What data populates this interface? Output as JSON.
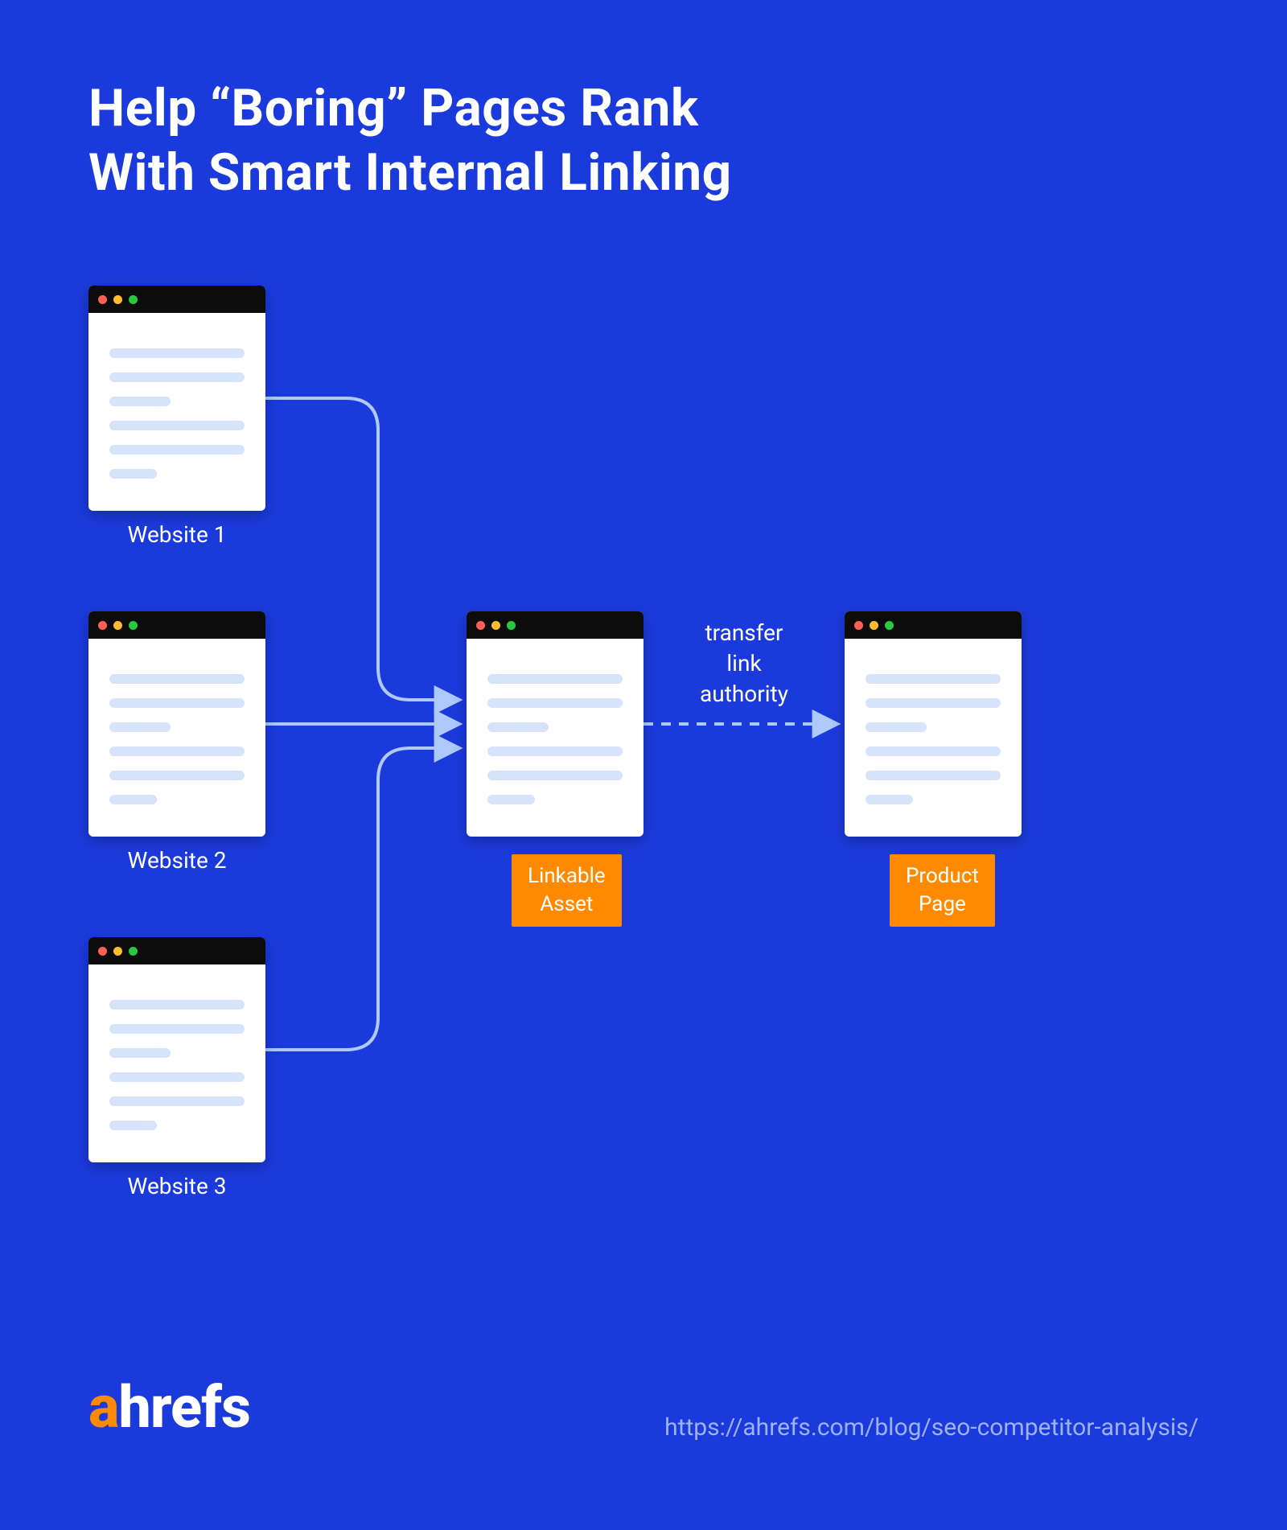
{
  "title": "Help “Boring” Pages Rank\nWith Smart Internal Linking",
  "websites": [
    {
      "label": "Website 1"
    },
    {
      "label": "Website 2"
    },
    {
      "label": "Website 3"
    }
  ],
  "linkable_asset_tag": "Linkable\nAsset",
  "product_page_tag": "Product\nPage",
  "transfer_label": "transfer\nlink\nauthority",
  "brand": {
    "accent": "a",
    "rest": "hrefs"
  },
  "source_url": "https://ahrefs.com/blog/seo-competitor-analysis/"
}
